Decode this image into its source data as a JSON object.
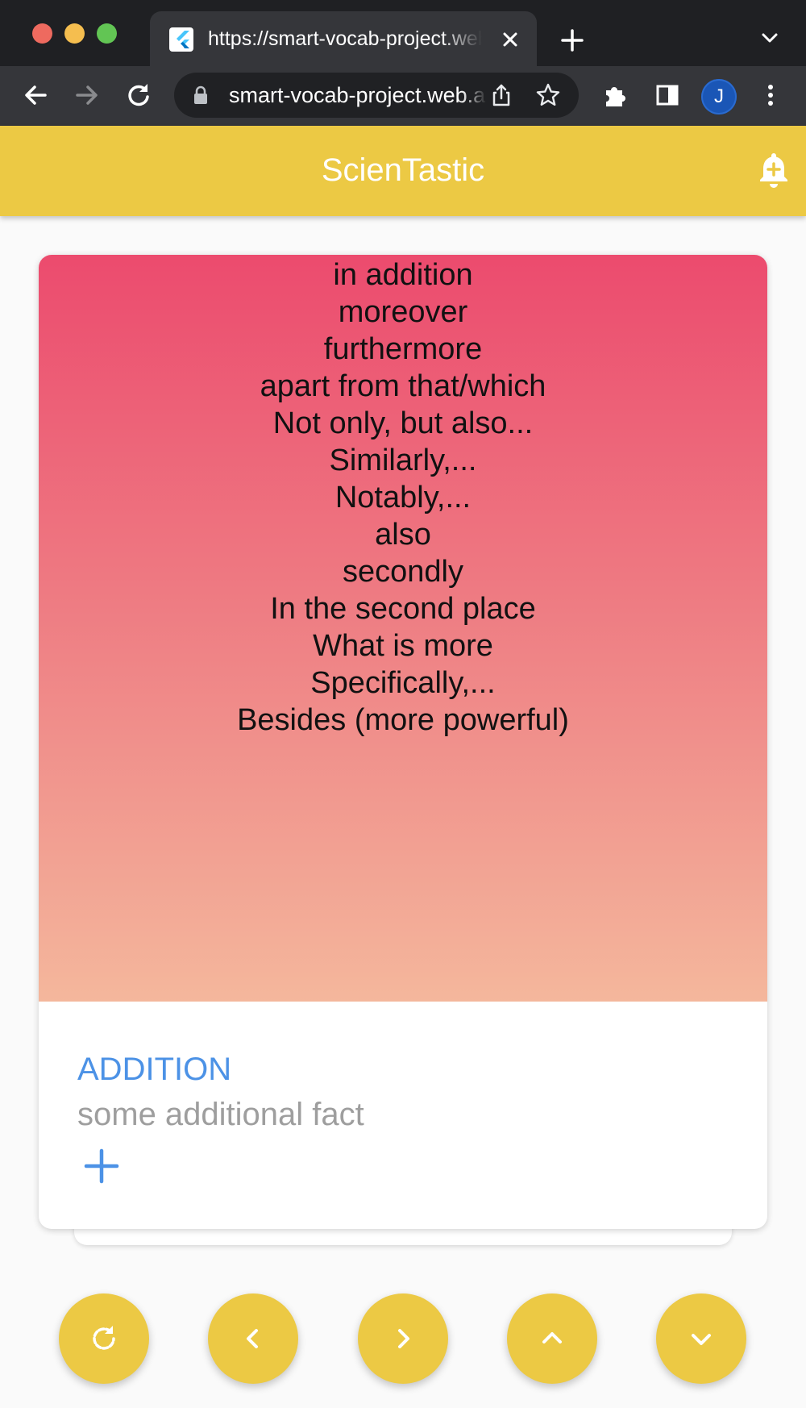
{
  "browser": {
    "tab_title": "https://smart-vocab-project.web.app",
    "address": "smart-vocab-project.web.app",
    "profile_initial": "J"
  },
  "app": {
    "title": "ScienTastic"
  },
  "card": {
    "phrases": [
      "in addition",
      "moreover",
      "furthermore",
      "apart from that/which",
      "Not only, but also...",
      "Similarly,...",
      "Notably,...",
      "also",
      "secondly",
      "In the second place",
      "What is more",
      "Specifically,...",
      "Besides (more powerful)"
    ],
    "category": "ADDITION",
    "fact": "some additional fact"
  },
  "colors": {
    "accent_yellow": "#ecc944",
    "gradient_top": "#ec4b6e",
    "gradient_bottom": "#f4b79c",
    "category_blue": "#4c92e6"
  },
  "icons": {
    "fab_1": "rotate-icon",
    "fab_2": "chevron-left-icon",
    "fab_3": "chevron-right-icon",
    "fab_4": "chevron-up-icon",
    "fab_5": "chevron-down-icon"
  }
}
